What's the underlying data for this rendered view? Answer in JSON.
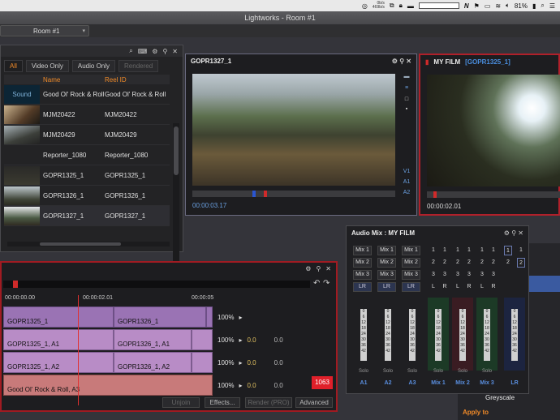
{
  "menubar": {
    "net_up": "0b/s",
    "net_down": "469b/s",
    "n_icon": "N",
    "battery": "81%",
    "icons": [
      "creative-cloud-icon",
      "dropbox-icon",
      "wifi-icon",
      "volume-icon",
      "battery-icon",
      "search-icon",
      "menu-icon"
    ]
  },
  "window": {
    "title": "Lightworks - Room #1"
  },
  "room": {
    "label": "Room #1",
    "dropdown": "▾"
  },
  "bin": {
    "icons": [
      "search-icon",
      "keyboard-icon",
      "link-icon",
      "pin-icon",
      "close-icon"
    ],
    "tabs": [
      {
        "label": "All"
      },
      {
        "label": "Video Only"
      },
      {
        "label": "Audio Only"
      },
      {
        "label": "Rendered"
      }
    ],
    "columns": {
      "name": "Name",
      "reel": "Reel ID"
    },
    "rows": [
      {
        "thumb": "Sound",
        "name": "Good Ol' Rock & Roll",
        "reel": "Good Ol' Rock & Roll"
      },
      {
        "thumb": "",
        "name": "MJM20422",
        "reel": "MJM20422"
      },
      {
        "thumb": "",
        "name": "MJM20429",
        "reel": "MJM20429"
      },
      {
        "thumb": "",
        "name": "Reporter_1080",
        "reel": "Reporter_1080"
      },
      {
        "thumb": "",
        "name": "GOPR1325_1",
        "reel": "GOPR1325_1"
      },
      {
        "thumb": "",
        "name": "GOPR1326_1",
        "reel": "GOPR1326_1"
      },
      {
        "thumb": "",
        "name": "GOPR1327_1",
        "reel": "GOPR1327_1"
      }
    ]
  },
  "viewer1": {
    "title": "GOPR1327_1",
    "timecode": "00:00:03.17",
    "side_labels": [
      "V1",
      "A1",
      "A2"
    ]
  },
  "viewer2": {
    "title": "MY FILM",
    "subtitle": "[GOPR1325_1]",
    "timecode": "00:00:02.01"
  },
  "timeline": {
    "tc_start": "00:00:00.00",
    "tc_playhead": "00:00:02.01",
    "tc_end": "00:00:05",
    "tracks": [
      {
        "clips": [
          "GOPR1325_1",
          "GOPR1326_1"
        ],
        "level": "100%",
        "pan": "",
        "gain": ""
      },
      {
        "clips": [
          "GOPR1325_1, A1",
          "GOPR1326_1, A1"
        ],
        "level": "100%",
        "pan": "0.0",
        "gain": "0.0"
      },
      {
        "clips": [
          "GOPR1325_1, A2",
          "GOPR1326_1, A2"
        ],
        "level": "100%",
        "pan": "0.0",
        "gain": "0.0"
      },
      {
        "clips": [
          "Good Ol' Rock & Roll, A3"
        ],
        "level": "100%",
        "pan": "0.0",
        "gain": "0.0"
      }
    ],
    "badge": "1063",
    "buttons": {
      "unjoin": "Unjoin",
      "effects": "Effects...",
      "render": "Render (PRO)",
      "advanced": "Advanced"
    }
  },
  "audiomix": {
    "title": "Audio Mix : MY FILM",
    "mix_rows": [
      [
        "Mix 1",
        "Mix 1",
        "Mix 1"
      ],
      [
        "Mix 2",
        "Mix 2",
        "Mix 2"
      ],
      [
        "Mix 3",
        "Mix 3",
        "Mix 3"
      ],
      [
        "LR",
        "LR",
        "LR"
      ]
    ],
    "numeric_rows": [
      [
        "1",
        "1",
        "1",
        "1",
        "1",
        "1"
      ],
      [
        "2",
        "2",
        "2",
        "2",
        "2",
        "2"
      ],
      [
        "3",
        "3",
        "3",
        "3",
        "3",
        "3"
      ],
      [
        "L",
        "L",
        "L",
        "L",
        "L",
        "L"
      ],
      [
        "R",
        "R",
        "R",
        "R",
        "R",
        "R"
      ]
    ],
    "right_col": [
      [
        "1",
        "1"
      ],
      [
        "2",
        "2"
      ]
    ],
    "fader_scale": [
      "0",
      "6",
      "12",
      "18",
      "24",
      "30",
      "36",
      "42"
    ],
    "solo": "Solo",
    "channels": [
      "A1",
      "A2",
      "A3",
      "Mix 1",
      "Mix 2",
      "Mix 3",
      "LR"
    ]
  },
  "rightpanel": {
    "greyscale": "Greyscale",
    "apply": "Apply to"
  }
}
